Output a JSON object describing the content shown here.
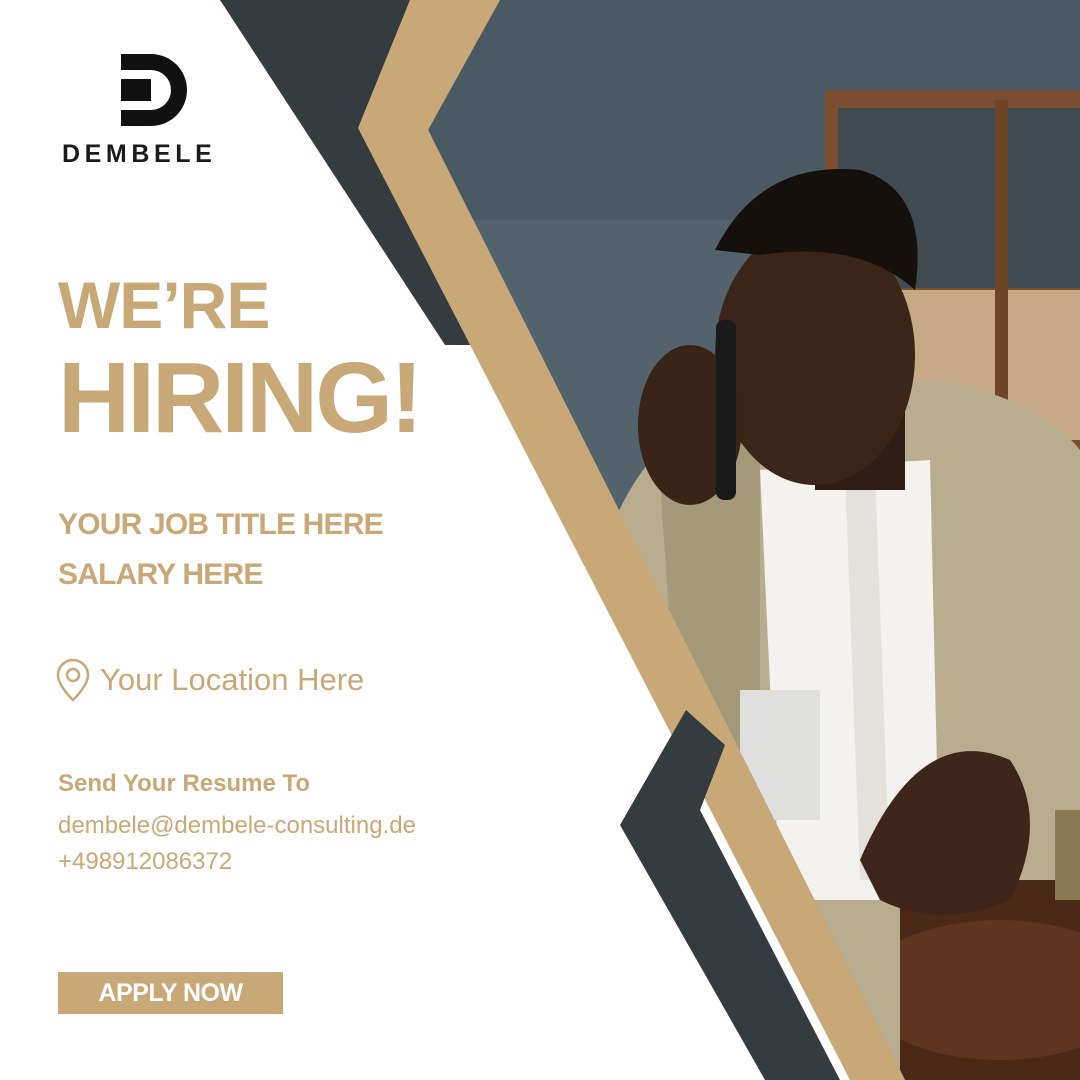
{
  "brand": {
    "name": "DEMBELE",
    "colors": {
      "gold": "#c9a877",
      "charcoal": "#343c40",
      "photo_wall": "#52636c"
    }
  },
  "headline": {
    "line1": "WE’RE",
    "line2": "HIRING!"
  },
  "job": {
    "title": "YOUR JOB TITLE HERE",
    "salary": "SALARY HERE"
  },
  "location": {
    "icon": "location-pin-icon",
    "text": "Your Location Here"
  },
  "contact": {
    "label": "Send Your Resume To",
    "email": "dembele@dembele-consulting.de",
    "phone": "+498912086372"
  },
  "cta": {
    "label": "APPLY NOW"
  }
}
